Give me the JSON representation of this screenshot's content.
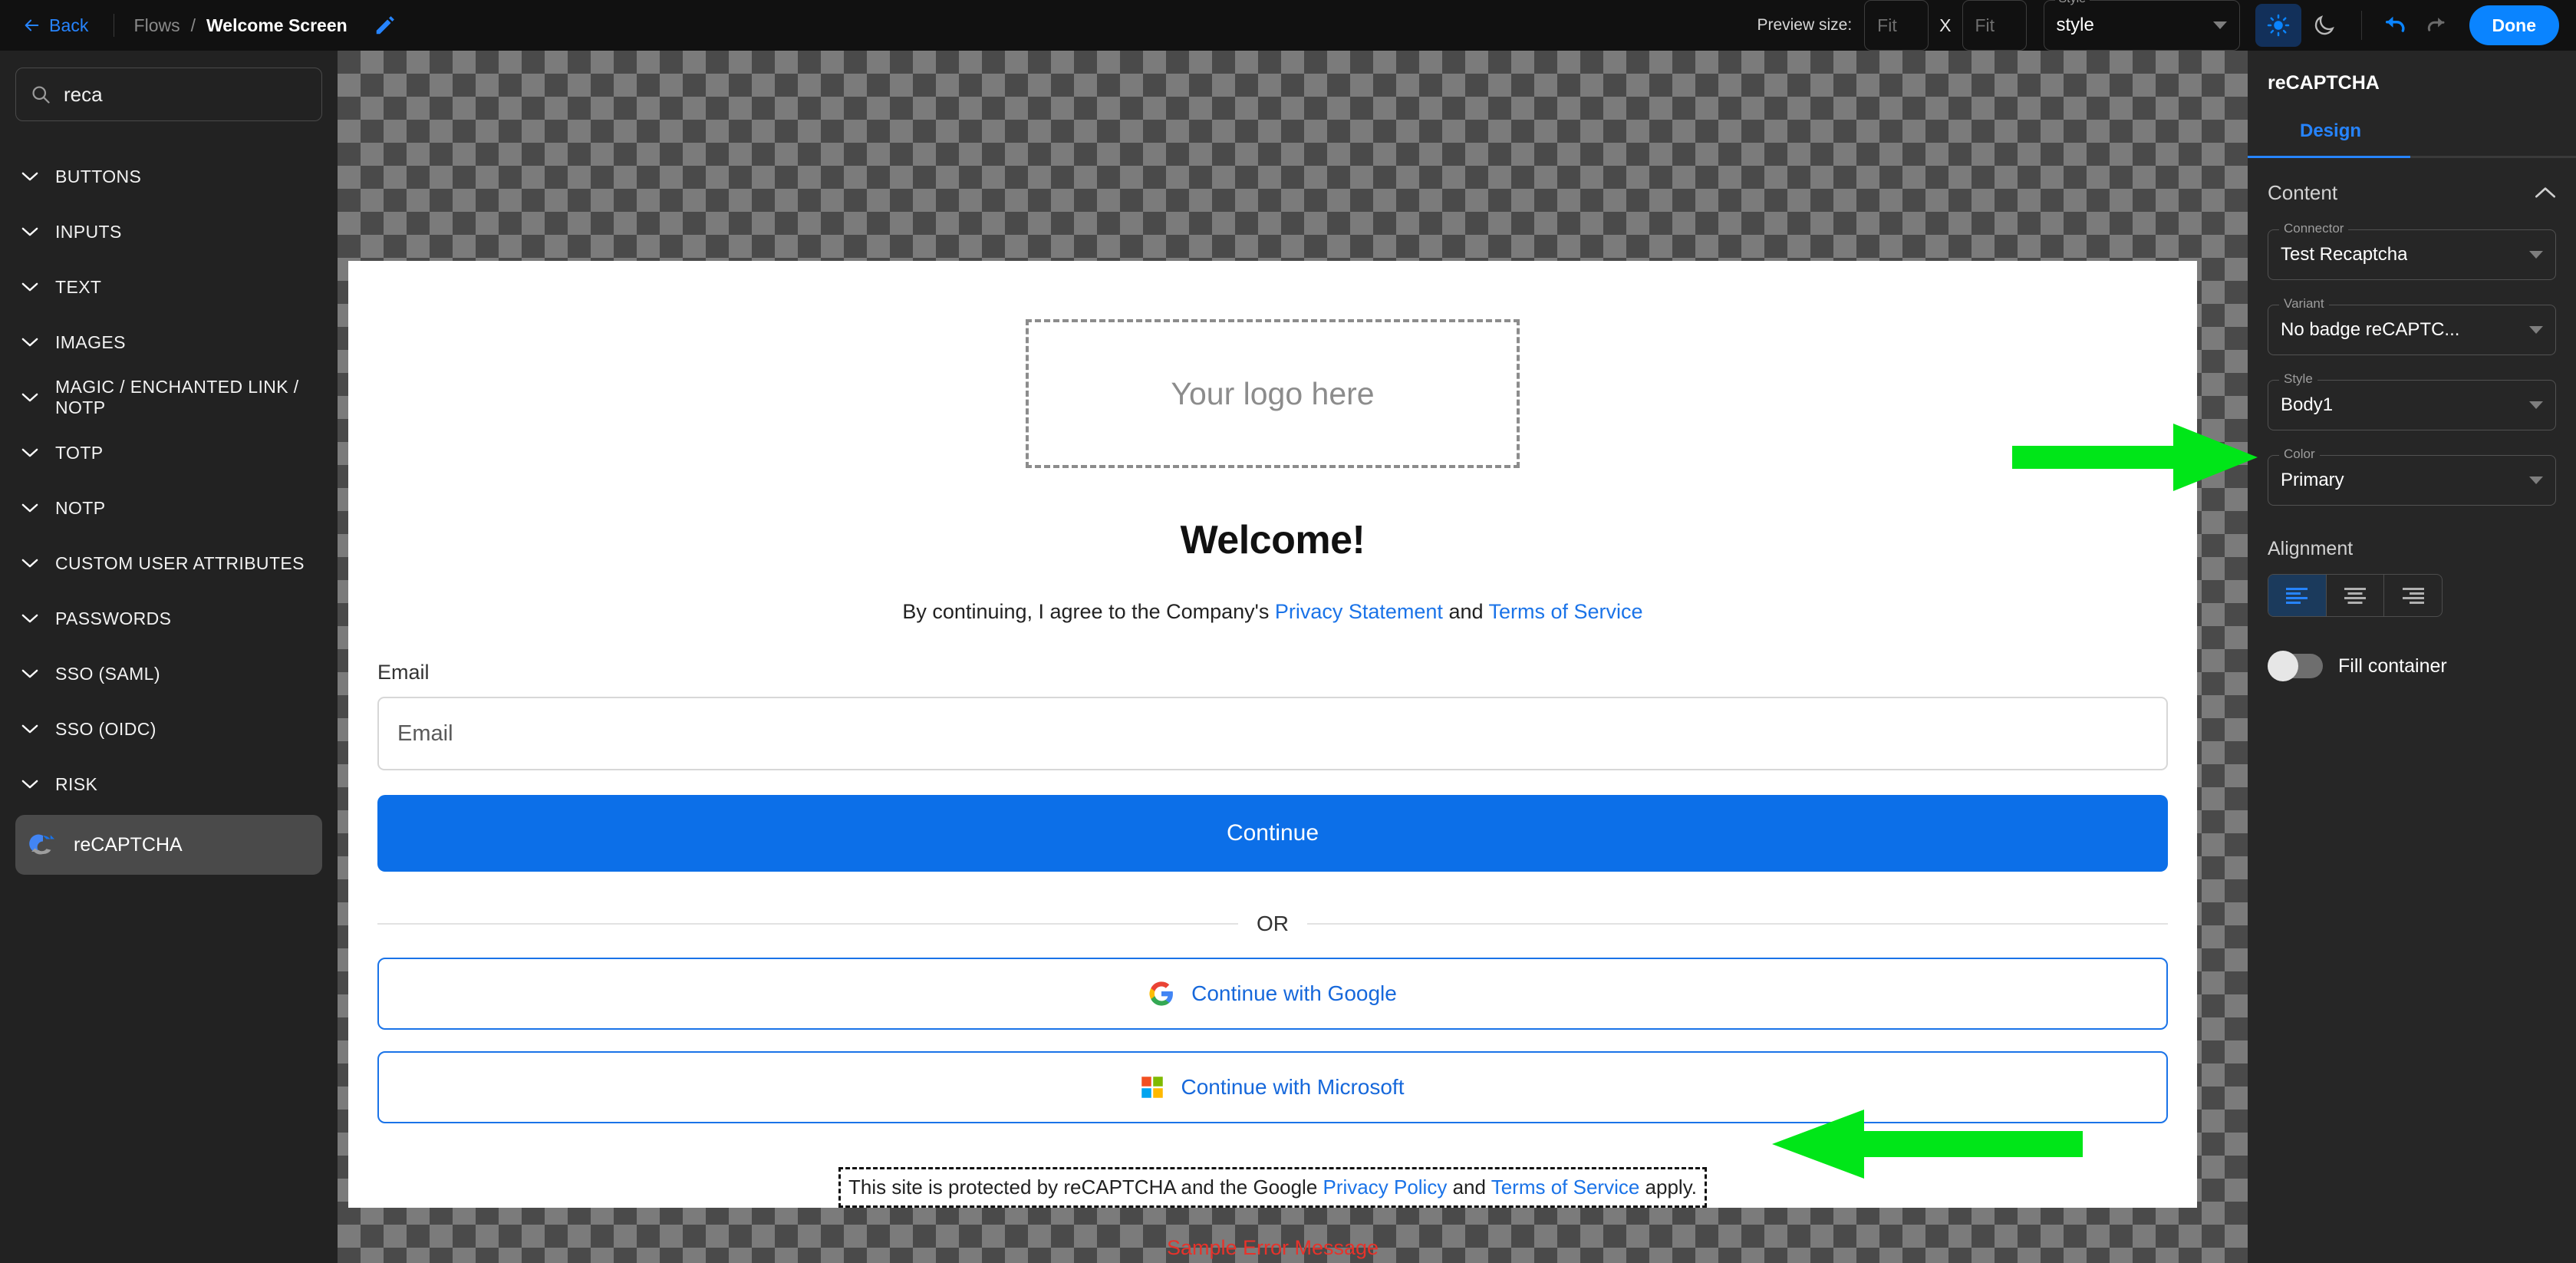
{
  "topbar": {
    "back_label": "Back",
    "breadcrumb_root": "Flows",
    "breadcrumb_sep": "/",
    "breadcrumb_current": "Welcome Screen",
    "preview_size_label": "Preview size:",
    "width_placeholder": "Fit",
    "height_placeholder": "Fit",
    "size_separator": "X",
    "style_legend": "Style",
    "style_value": "style",
    "done_label": "Done",
    "accent_color": "#0A84FF"
  },
  "sidebar": {
    "search_value": "reca",
    "categories": [
      {
        "label": "BUTTONS"
      },
      {
        "label": "INPUTS"
      },
      {
        "label": "TEXT"
      },
      {
        "label": "IMAGES"
      },
      {
        "label": "MAGIC / ENCHANTED LINK / NOTP"
      },
      {
        "label": "TOTP"
      },
      {
        "label": "NOTP"
      },
      {
        "label": "CUSTOM USER ATTRIBUTES"
      },
      {
        "label": "PASSWORDS"
      },
      {
        "label": "SSO (SAML)"
      },
      {
        "label": "SSO (OIDC)"
      },
      {
        "label": "RISK"
      }
    ],
    "selected_item": "reCAPTCHA"
  },
  "canvas": {
    "logo_placeholder": "Your logo here",
    "heading": "Welcome!",
    "consent_prefix": "By continuing, I agree to the Company's ",
    "consent_link1": "Privacy Statement",
    "consent_and": " and ",
    "consent_link2": "Terms of Service",
    "email_label": "Email",
    "email_value": "",
    "email_placeholder": "Email",
    "continue_label": "Continue",
    "or_label": "OR",
    "google_label": "Continue with Google",
    "microsoft_label": "Continue with Microsoft",
    "captcha_prefix": "This site is protected by reCAPTCHA and the Google ",
    "captcha_link1": "Privacy Policy",
    "captcha_and": " and ",
    "captcha_link2": "Terms of Service",
    "captcha_suffix": " apply.",
    "error_message": "Sample Error Message",
    "primary_button_color": "#0C6FE8",
    "link_color": "#1a73e8",
    "error_color": "#e8322a"
  },
  "rightpanel": {
    "title": "reCAPTCHA",
    "tab_design": "Design",
    "section_content": "Content",
    "connector_legend": "Connector",
    "connector_value": "Test Recaptcha",
    "variant_legend": "Variant",
    "variant_value": "No badge reCAPTC...",
    "style_legend": "Style",
    "style_value": "Body1",
    "color_legend": "Color",
    "color_value": "Primary",
    "alignment_label": "Alignment",
    "alignment_selected": "left",
    "fill_container_label": "Fill container",
    "fill_container_on": false,
    "accent_color": "#2684FF"
  },
  "annotations": {
    "arrow_color": "#00E618",
    "arrow_variant_target": "Variant",
    "arrow_captcha_target": "reCAPTCHA legal text"
  }
}
